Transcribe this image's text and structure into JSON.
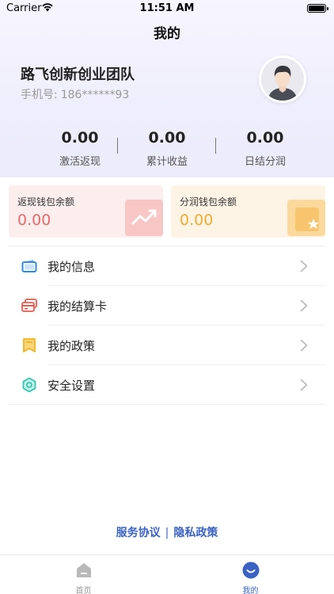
{
  "status_bar": {
    "carrier": "Carrier",
    "time": "11:51 AM"
  },
  "nav": {
    "title": "我的"
  },
  "profile": {
    "team_name": "路飞创新创业团队",
    "phone_label": "手机号:",
    "phone_value": "186******93"
  },
  "stats": [
    {
      "value": "0.00",
      "label": "激活返现"
    },
    {
      "value": "0.00",
      "label": "累计收益"
    },
    {
      "value": "0.00",
      "label": "日结分润"
    }
  ],
  "wallets": [
    {
      "title": "返现钱包余额",
      "amount": "0.00",
      "color": "#e8686a"
    },
    {
      "title": "分润钱包余额",
      "amount": "0.00",
      "color": "#f0ac2e"
    }
  ],
  "menu": [
    {
      "label": "我的信息",
      "icon": "wallet-icon",
      "color": "#2f88e6"
    },
    {
      "label": "我的结算卡",
      "icon": "card-icon",
      "color": "#ea5a4f"
    },
    {
      "label": "我的政策",
      "icon": "bookmark-icon",
      "color": "#f2b21e"
    },
    {
      "label": "安全设置",
      "icon": "hexagon-icon",
      "color": "#2fc7b0"
    }
  ],
  "links": {
    "service": "服务协议",
    "separator": "|",
    "privacy": "隐私政策"
  },
  "tabs": [
    {
      "label": "首页",
      "icon": "home-icon",
      "active": false
    },
    {
      "label": "我的",
      "icon": "profile-icon",
      "active": true
    }
  ],
  "colors": {
    "accent": "#3a62c4",
    "header_bg": "#efeefc"
  }
}
